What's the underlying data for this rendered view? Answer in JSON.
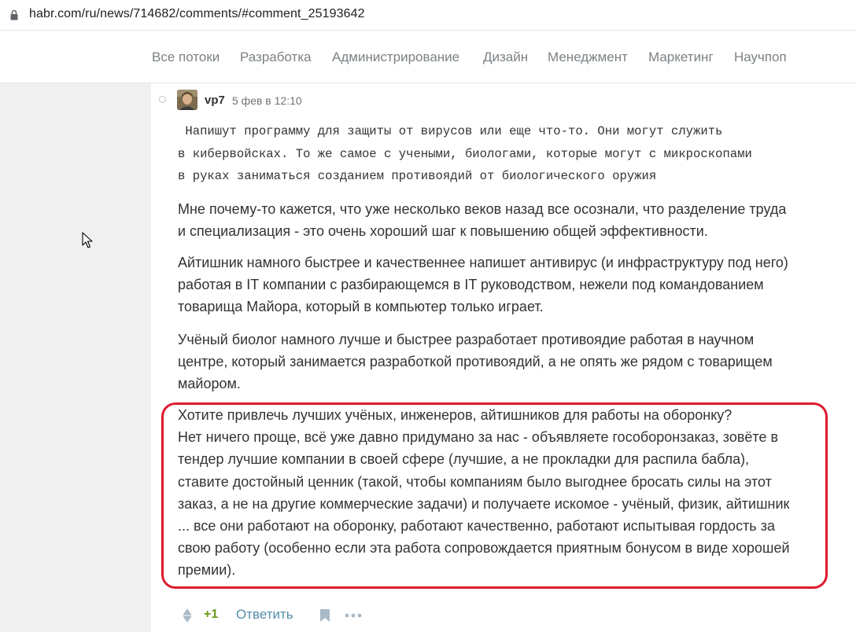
{
  "browser": {
    "url": "habr.com/ru/news/714682/comments/#comment_25193642"
  },
  "nav": {
    "items": [
      {
        "label": "Все потоки"
      },
      {
        "label": "Разработка"
      },
      {
        "label": "Администрирование"
      },
      {
        "label": "Дизайн"
      },
      {
        "label": "Менеджмент"
      },
      {
        "label": "Маркетинг"
      },
      {
        "label": "Научпоп"
      }
    ]
  },
  "comment": {
    "author": "vp7",
    "timestamp": "5 фев в 12:10",
    "quote_lines": [
      " Напишут программу для защиты от вирусов или еще что-то. Они могут служить",
      "в кибервойсках. То же самое с учеными, биологами, которые могут с микроскопами",
      "в руках заниматься созданием противоядий от биологического оружия"
    ],
    "paragraphs": [
      {
        "lines": [
          "Мне почему-то кажется, что уже несколько веков назад все осознали, что разделение труда",
          "и специализация - это очень хороший шаг к повышению общей эффективности."
        ]
      },
      {
        "lines": [
          "Айтишник намного быстрее и качественнее напишет антивирус (и инфраструктуру под него)",
          "работая в IT компании с разбирающемся в IT руководством, нежели под командованием",
          "товарища Майора, который в компьютер только играет."
        ]
      },
      {
        "lines": [
          "Учёный биолог намного лучше и быстрее разработает противоядие работая в научном",
          "центре, который занимается разработкой противоядий, а не опять же рядом с товарищем",
          "майором."
        ]
      },
      {
        "lines": [
          "Хотите привлечь лучших учёных, инженеров, айтишников для работы на оборонку?",
          "Нет ничего проще, всё уже давно придумано за нас - объявляете гособоронзаказ, зовёте в",
          "тендер лучшие компании в своей сфере (лучшие, а не прокладки для распила бабла),",
          "ставите достойный ценник (такой, чтобы компаниям было выгоднее бросать силы на этот",
          "заказ, а не на другие коммерческие задачи) и получаете искомое - учёный, физик, айтишник",
          "... все они работают на оборонку, работают качественно, работают испытывая гордость за",
          "свою работу (особенно если эта работа сопровождается приятным бонусом в виде хорошей",
          "премии)."
        ]
      }
    ],
    "score": "+1",
    "reply_label": "Ответить"
  },
  "colors": {
    "highlight_border": "#e01b2f",
    "score_positive": "#6c9a1a",
    "reply_link": "#548eaa",
    "nav_text": "#7b8185"
  },
  "icons": [
    "lock-icon",
    "rating-arrows-icon",
    "bookmark-icon",
    "more-dots-icon",
    "mouse-cursor-icon"
  ]
}
